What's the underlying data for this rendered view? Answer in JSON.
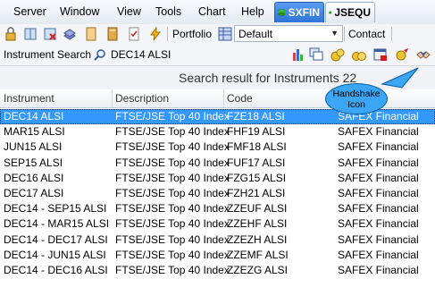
{
  "menu": {
    "items": [
      "Server",
      "Window",
      "View",
      "Tools",
      "Chart",
      "Help"
    ],
    "tabs": [
      {
        "label": "SXFIN",
        "active": true
      },
      {
        "label": "JSEQU",
        "active": false
      }
    ]
  },
  "toolbar": {
    "portfolio_label": "Portfolio",
    "portfolio_value": "Default",
    "contact_label": "Contact"
  },
  "search": {
    "label": "Instrument Search",
    "value": "DEC14 ALSI"
  },
  "result_header": "Search result for Instruments 22",
  "callout": {
    "line1": "Handshake",
    "line2": "Icon"
  },
  "table": {
    "columns": [
      "Instrument",
      "Description",
      "Code",
      ""
    ],
    "rows": [
      [
        "DEC14 ALSI",
        "FTSE/JSE Top 40 Index",
        "FZE18 ALSI",
        "SAFEX Financial"
      ],
      [
        "MAR15 ALSI",
        "FTSE/JSE Top 40 Index",
        "FHF19 ALSI",
        "SAFEX Financial"
      ],
      [
        "JUN15 ALSI",
        "FTSE/JSE Top 40 Index",
        "FMF18 ALSI",
        "SAFEX Financial"
      ],
      [
        "SEP15 ALSI",
        "FTSE/JSE Top 40 Index",
        "FUF17 ALSI",
        "SAFEX Financial"
      ],
      [
        "DEC16 ALSI",
        "FTSE/JSE Top 40 Index",
        "FZG15 ALSI",
        "SAFEX Financial"
      ],
      [
        "DEC17 ALSI",
        "FTSE/JSE Top 40 Index",
        "FZH21 ALSI",
        "SAFEX Financial"
      ],
      [
        "DEC14 - SEP15 ALSI",
        "FTSE/JSE Top 40 Index",
        "ZZEUF ALSI",
        "SAFEX Financial"
      ],
      [
        "DEC14 - MAR15 ALSI",
        "FTSE/JSE Top 40 Index",
        "ZZEHF ALSI",
        "SAFEX Financial"
      ],
      [
        "DEC14 - DEC17 ALSI",
        "FTSE/JSE Top 40 Index",
        "ZZEZH ALSI",
        "SAFEX Financial"
      ],
      [
        "DEC14 - JUN15 ALSI",
        "FTSE/JSE Top 40 Index",
        "ZZEMF ALSI",
        "SAFEX Financial"
      ],
      [
        "DEC14 - DEC16 ALSI",
        "FTSE/JSE Top 40 Index",
        "ZZEZG ALSI",
        "SAFEX Financial"
      ]
    ],
    "selected_row": 0
  },
  "colors": {
    "selection": "#3399ff",
    "active_tab": "#2f74d8",
    "callout": "#3aa6f5"
  }
}
